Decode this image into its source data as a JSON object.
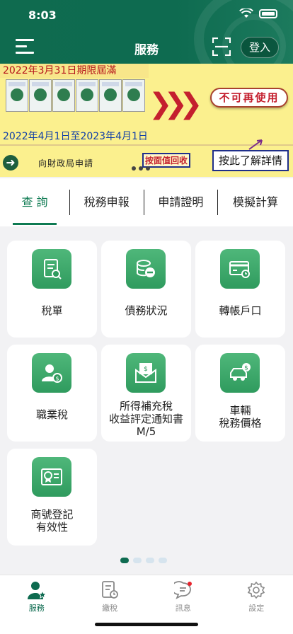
{
  "status": {
    "time": "8:03"
  },
  "header": {
    "title": "服務",
    "login_label": "登入"
  },
  "banner": {
    "deadline": "2022年3月31日期限屆滿",
    "no_longer_usable": "不可再使用",
    "period": "2022年4月1日至2023年4月1日",
    "apply_text": "向財政局申請",
    "recycle_label": "按面值回收",
    "details_label": "按此了解詳情"
  },
  "tabs": [
    {
      "label": "查 詢",
      "active": true
    },
    {
      "label": "稅務申報",
      "active": false
    },
    {
      "label": "申請證明",
      "active": false
    },
    {
      "label": "模擬計算",
      "active": false
    }
  ],
  "services": [
    {
      "label": "稅單",
      "icon": "tax-bill-icon"
    },
    {
      "label": "債務狀況",
      "icon": "debt-coins-icon"
    },
    {
      "label": "轉帳戶口",
      "icon": "bank-card-icon"
    },
    {
      "label": "職業稅",
      "icon": "profession-tax-icon"
    },
    {
      "label": "所得補充稅\n收益評定通知書\nM/5",
      "icon": "income-notice-icon"
    },
    {
      "label": "車輛\n稅務價格",
      "icon": "vehicle-icon"
    },
    {
      "label": "商號登記\n有效性",
      "icon": "certificate-icon"
    }
  ],
  "nav": [
    {
      "label": "服務",
      "active": true,
      "icon": "user-service-icon"
    },
    {
      "label": "繳稅",
      "active": false,
      "icon": "pay-tax-icon"
    },
    {
      "label": "訊息",
      "active": false,
      "icon": "message-icon"
    },
    {
      "label": "設定",
      "active": false,
      "icon": "gear-icon"
    }
  ],
  "colors": {
    "brand": "#0e6b50",
    "accent": "#2f9b5e",
    "banner_bg": "#fbf08e",
    "alert_red": "#c41f2e"
  }
}
